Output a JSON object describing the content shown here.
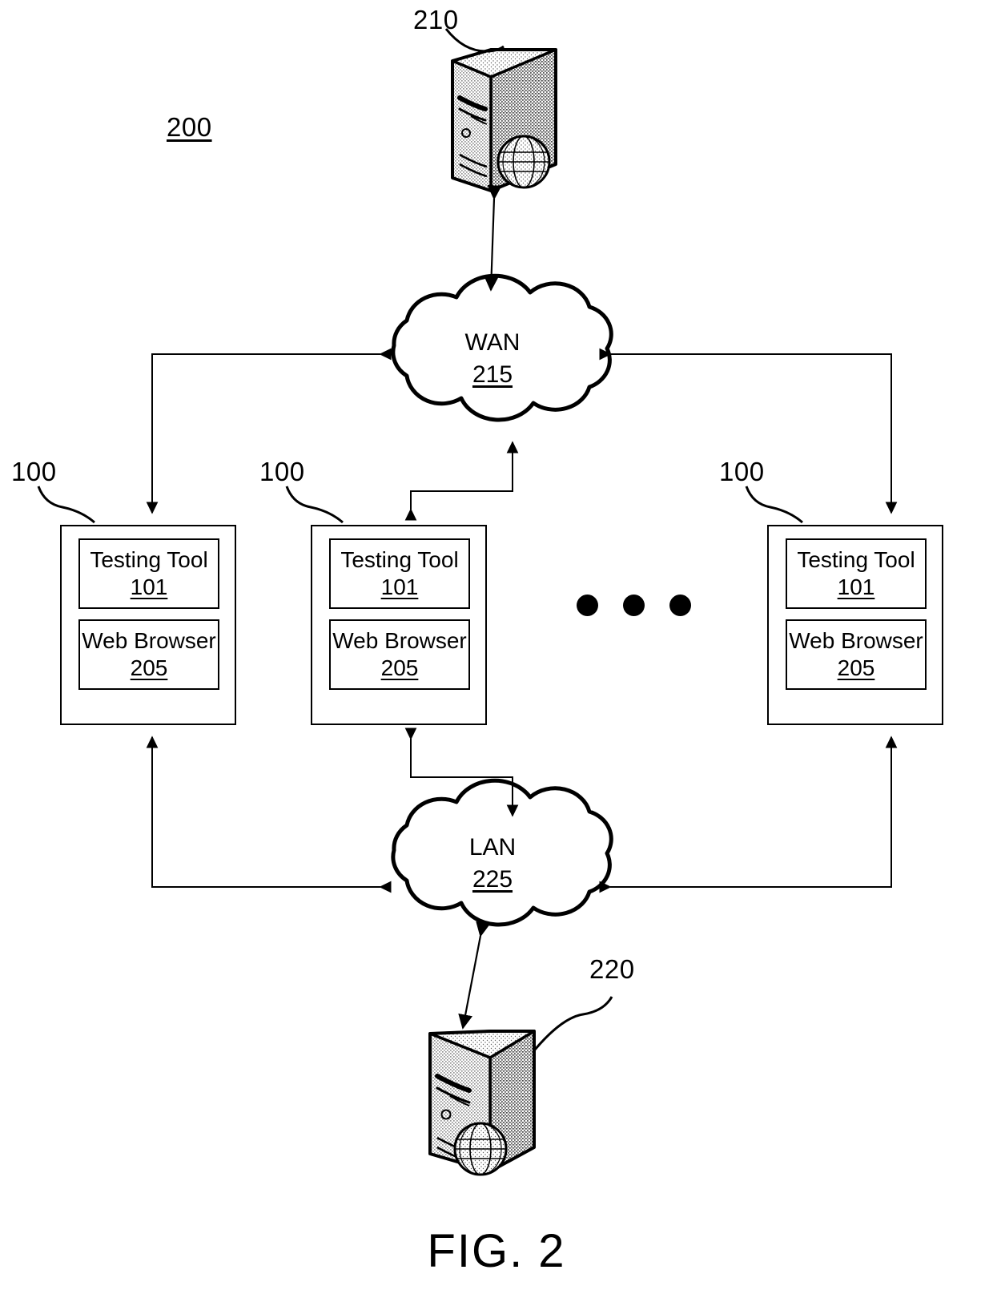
{
  "figure": {
    "caption": "FIG. 2",
    "system_ref": "200"
  },
  "nodes": {
    "remote_server": {
      "ref": "210",
      "icon": "server-globe-icon"
    },
    "local_server": {
      "ref": "220",
      "icon": "server-globe-icon"
    },
    "wan": {
      "label": "WAN",
      "ref": "215",
      "icon": "cloud-icon"
    },
    "lan": {
      "label": "LAN",
      "ref": "225",
      "icon": "cloud-icon"
    },
    "clients": [
      {
        "ref": "100",
        "testing_tool_label": "Testing Tool",
        "testing_tool_ref": "101",
        "web_browser_label": "Web Browser",
        "web_browser_ref": "205"
      },
      {
        "ref": "100",
        "testing_tool_label": "Testing Tool",
        "testing_tool_ref": "101",
        "web_browser_label": "Web Browser",
        "web_browser_ref": "205"
      },
      {
        "ref": "100",
        "testing_tool_label": "Testing Tool",
        "testing_tool_ref": "101",
        "web_browser_label": "Web Browser",
        "web_browser_ref": "205"
      }
    ],
    "ellipsis": {
      "name": "more-clients-ellipsis",
      "count": 3
    }
  },
  "colors": {
    "line": "#000000",
    "background": "#ffffff",
    "fill": "#ffffff"
  }
}
